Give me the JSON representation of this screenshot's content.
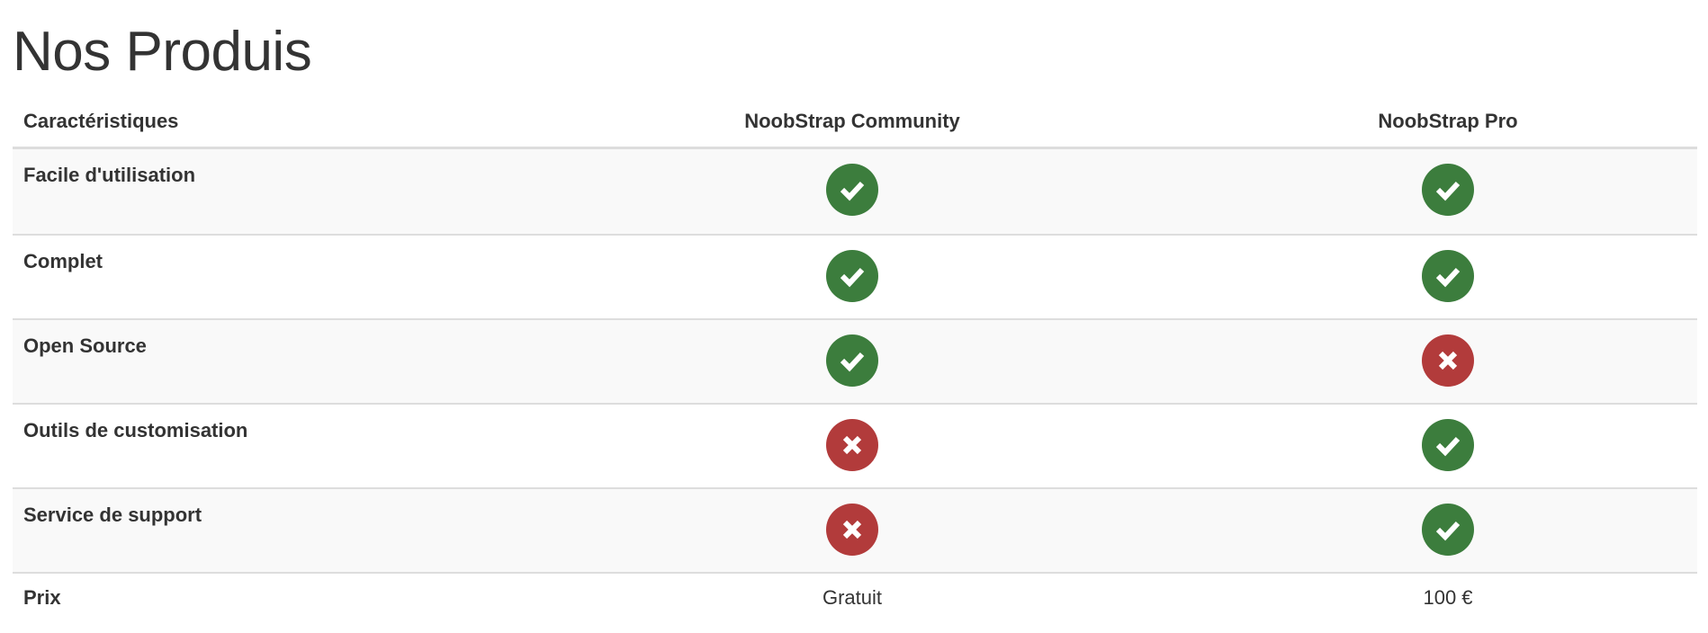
{
  "title": "Nos Produis",
  "table": {
    "columns": [
      "Caractéristiques",
      "NoobStrap Community",
      "NoobStrap Pro"
    ],
    "features": [
      {
        "label": "Facile d'utilisation",
        "community": "check",
        "pro": "check"
      },
      {
        "label": "Complet",
        "community": "check",
        "pro": "check"
      },
      {
        "label": "Open Source",
        "community": "check",
        "pro": "cross"
      },
      {
        "label": "Outils de customisation",
        "community": "cross",
        "pro": "check"
      },
      {
        "label": "Service de support",
        "community": "cross",
        "pro": "check"
      }
    ],
    "price": {
      "label": "Prix",
      "community": "Gratuit",
      "pro": "100 €"
    }
  },
  "colors": {
    "check": "#3c7d3d",
    "cross": "#b23b3b",
    "stripe": "#f9f9f9",
    "border": "#dddddd"
  },
  "icons": {
    "check": "check-circle-icon",
    "cross": "times-circle-icon"
  }
}
